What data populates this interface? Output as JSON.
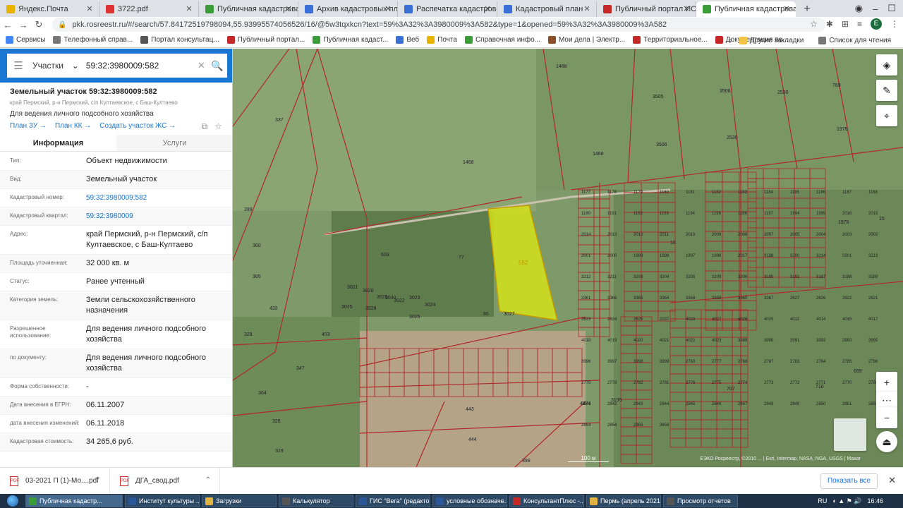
{
  "browser": {
    "tabs": [
      {
        "label": "Яндекс.Почта",
        "icon": "mail-icon",
        "color": "#e8b400"
      },
      {
        "label": "3722.pdf",
        "icon": "pdf-icon",
        "color": "#d33"
      },
      {
        "label": "Публичная кадастровая к",
        "icon": "rosreestr-icon",
        "color": "#3a9d3a"
      },
      {
        "label": "Архив кадастровых планов",
        "icon": "diamond-icon",
        "color": "#3a6fd8"
      },
      {
        "label": "Распечатка кадастровой к",
        "icon": "diamond-icon",
        "color": "#3a6fd8"
      },
      {
        "label": "Кадастровый план",
        "icon": "diamond-icon",
        "color": "#3a6fd8"
      },
      {
        "label": "Публичный портал ИСОГД",
        "icon": "portal-icon",
        "color": "#c62828"
      },
      {
        "label": "Публичная кадастровая к",
        "icon": "rosreestr-icon",
        "color": "#3a9d3a",
        "active": true
      }
    ],
    "url": "pkk.rosreestr.ru/#/search/57.84172519798094,55.93995574056526/16/@5w3tqxkcn?text=59%3A32%3A3980009%3A582&type=1&opened=59%3A32%3A3980009%3A582",
    "profile_initial": "E",
    "bookmarks": [
      {
        "label": "Сервисы",
        "color": "#4285f4"
      },
      {
        "label": "Телефонный справ...",
        "color": "#777"
      },
      {
        "label": "Портал консультац...",
        "color": "#555"
      },
      {
        "label": "Публичный портал...",
        "color": "#c62828"
      },
      {
        "label": "Публичная кадаст...",
        "color": "#3a9d3a"
      },
      {
        "label": "Веб",
        "color": "#3a6fd8"
      },
      {
        "label": "Почта",
        "color": "#e8b400"
      },
      {
        "label": "Справочная инфо...",
        "color": "#3a9d3a"
      },
      {
        "label": "Мои дела | Электр...",
        "color": "#8d4f2a"
      },
      {
        "label": "Территориальное...",
        "color": "#c62828"
      },
      {
        "label": "Документация по...",
        "color": "#c62828"
      }
    ],
    "other_bookmarks": "Другие закладки",
    "reading_list": "Список для чтения"
  },
  "search": {
    "type": "Участки",
    "query": "59:32:3980009:582"
  },
  "object": {
    "title": "Земельный участок 59:32:3980009:582",
    "address_line": "край Пермский, р-н Пермский, с/п Култаевское, с Баш-Култаево",
    "purpose": "Для ведения личного подсобного хозяйства",
    "links": [
      "План ЗУ",
      "План КК",
      "Создать участок ЖС"
    ],
    "tabs": [
      "Информация",
      "Услуги"
    ]
  },
  "info_rows": [
    {
      "k": "Тип:",
      "v": "Объект недвижимости"
    },
    {
      "k": "Вид:",
      "v": "Земельный участок"
    },
    {
      "k": "Кадастровый номер:",
      "v": "59:32:3980009:582",
      "link": true
    },
    {
      "k": "Кадастровый квартал:",
      "v": "59:32:3980009",
      "link": true
    },
    {
      "k": "Адрес:",
      "v": "край Пермский, р-н Пермский, с/п Култаевское, с Баш-Култаево"
    },
    {
      "k": "Площадь уточненная:",
      "v": "32 000 кв. м"
    },
    {
      "k": "Статус:",
      "v": "Ранее учтенный"
    },
    {
      "k": "Категория земель:",
      "v": "Земли сельскохозяйственного назначения"
    },
    {
      "k": "Разрешенное использование:",
      "v": "Для ведения личного подсобного хозяйства"
    },
    {
      "k": "по документу:",
      "v": "Для ведения личного подсобного хозяйства"
    },
    {
      "k": "Форма собственности:",
      "v": "-"
    },
    {
      "k": "Дата внесения в ЕГРН:",
      "v": "06.11.2007"
    },
    {
      "k": "дата внесения изменений:",
      "v": "06.11.2018"
    },
    {
      "k": "Кадастровая стоимость:",
      "v": "34 265,6 руб."
    }
  ],
  "map": {
    "selected_label": "582",
    "scale_label": "100 м",
    "attribution": "ЕЭКО Росреестр, ©2010 ... | Esri, Intermap, NASA, NGA, USGS | Maxar",
    "labels": [
      "1468",
      "337",
      "289",
      "360",
      "365",
      "433",
      "328",
      "347",
      "364",
      "326",
      "329",
      "603",
      "77",
      "1468",
      "1468",
      "3505",
      "3506",
      "3506",
      "2530",
      "2530",
      "769",
      "1976",
      "1976",
      "15",
      "16",
      "453",
      "443",
      "444",
      "398",
      "4874",
      "707",
      "710",
      "659",
      "3195",
      "86",
      "3027",
      "3026",
      "3022",
      "3021",
      "3020",
      "3023",
      "3024",
      "3025",
      "3028",
      "3029",
      "3030",
      "1177",
      "1178",
      "1179",
      "1180",
      "1181",
      "1182",
      "1183",
      "1184",
      "1185",
      "1186",
      "1187",
      "1188",
      "1189",
      "1191",
      "1192",
      "1193",
      "1194",
      "1195",
      "1196",
      "1197",
      "1994",
      "1995",
      "2016",
      "2015",
      "2014",
      "2013",
      "2012",
      "2011",
      "2010",
      "2009",
      "2008",
      "2007",
      "2005",
      "2004",
      "2003",
      "2002",
      "2001",
      "2000",
      "1999",
      "1998",
      "1997",
      "1996",
      "2017",
      "3198",
      "3200",
      "3214",
      "3201",
      "3213",
      "3212",
      "3211",
      "3203",
      "3204",
      "3205",
      "3209",
      "3206",
      "3190",
      "3191",
      "3187",
      "3188",
      "3189",
      "3361",
      "3366",
      "3365",
      "3364",
      "3358",
      "3359",
      "3360",
      "3367",
      "2627",
      "2626",
      "2622",
      "2621",
      "2623",
      "2624",
      "2625",
      "2037",
      "4028",
      "4027",
      "4026",
      "4025",
      "4013",
      "4014",
      "4015",
      "4017",
      "4018",
      "4019",
      "4020",
      "4021",
      "4022",
      "4023",
      "3989",
      "3990",
      "3991",
      "3992",
      "3993",
      "3995",
      "3996",
      "3997",
      "3998",
      "3999",
      "2780",
      "2777",
      "2788",
      "2787",
      "2783",
      "2784",
      "2785",
      "2786",
      "2779",
      "2778",
      "2782",
      "2781",
      "2776",
      "2775",
      "2774",
      "2773",
      "2772",
      "2771",
      "2770",
      "2769",
      "2841",
      "2842",
      "2843",
      "2844",
      "2845",
      "2846",
      "2847",
      "2848",
      "2849",
      "2850",
      "2851",
      "2852",
      "2853",
      "2854",
      "2855",
      "2856"
    ]
  },
  "downloads": [
    {
      "name": "03-2021 П (1)-Мо....pdf"
    },
    {
      "name": "ДГА_свод.pdf"
    }
  ],
  "downloads_show_all": "Показать все",
  "taskbar": {
    "items": [
      {
        "label": "Публичная кадастр...",
        "color": "#3a9d3a",
        "active": true
      },
      {
        "label": "Институт культуры ...",
        "color": "#2b5797"
      },
      {
        "label": "Загрузки",
        "color": "#e3b341"
      },
      {
        "label": "Калькулятор",
        "color": "#555"
      },
      {
        "label": "ГИС \"Вега\" (редакто...",
        "color": "#2b5797"
      },
      {
        "label": "условные обозначе...",
        "color": "#2b5797"
      },
      {
        "label": "КонсультантПлюс -...",
        "color": "#c62828"
      },
      {
        "label": "Пермь (апрель 2021...",
        "color": "#e3b341"
      },
      {
        "label": "Просмотр отчетов",
        "color": "#555"
      }
    ],
    "lang": "RU",
    "time": "16:46"
  }
}
